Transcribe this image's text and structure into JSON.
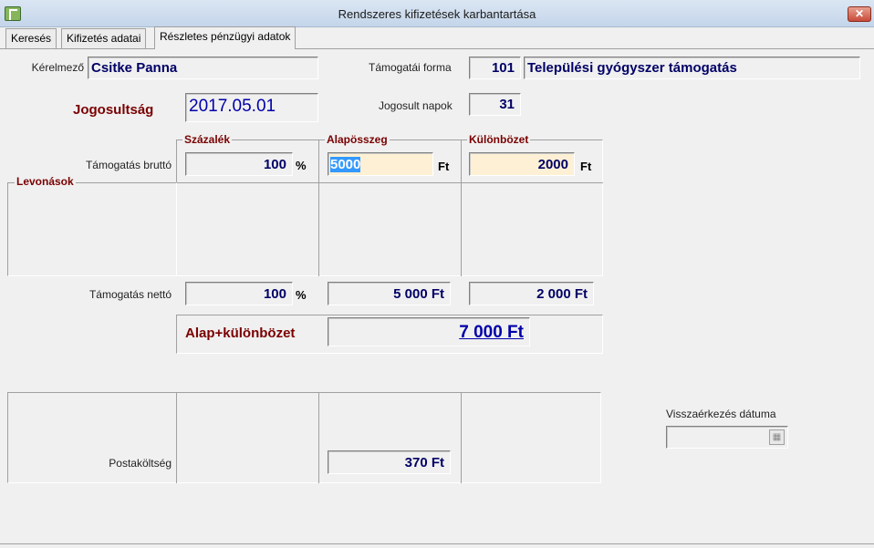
{
  "window": {
    "title": "Rendszeres kifizetések karbantartása",
    "close_label": "✕"
  },
  "tabs": [
    {
      "label": "Keresés"
    },
    {
      "label": "Kifizetés adatai"
    },
    {
      "label": "Részletes pénzügyi adatok"
    }
  ],
  "applicant": {
    "label": "Kérelmező",
    "value": "Csitke Panna"
  },
  "support_form": {
    "label": "Támogatái forma",
    "code": "101",
    "name": "Települési gyógyszer támogatás"
  },
  "entitlement": {
    "label": "Jogosultság",
    "date": "2017.05.01"
  },
  "entitled_days": {
    "label": "Jogosult napok",
    "value": "31"
  },
  "columns": {
    "percent": "Százalék",
    "base": "Alapösszeg",
    "difference": "Különbözet"
  },
  "gross": {
    "label": "Támogatás bruttó",
    "percent": "100",
    "percent_suffix": "%",
    "base": "5000",
    "base_suffix": "Ft",
    "difference": "2000",
    "difference_suffix": "Ft"
  },
  "deductions": {
    "label": "Levonások"
  },
  "net": {
    "label": "Támogatás nettó",
    "percent": "100",
    "percent_suffix": "%",
    "base": "5 000 Ft",
    "difference": "2 000 Ft"
  },
  "total": {
    "label": "Alap+különbözet",
    "value": "7 000 Ft"
  },
  "postage": {
    "label": "Postaköltség",
    "value": "370 Ft"
  },
  "return_date": {
    "label": "Visszaérkezés dátuma",
    "value": ""
  }
}
